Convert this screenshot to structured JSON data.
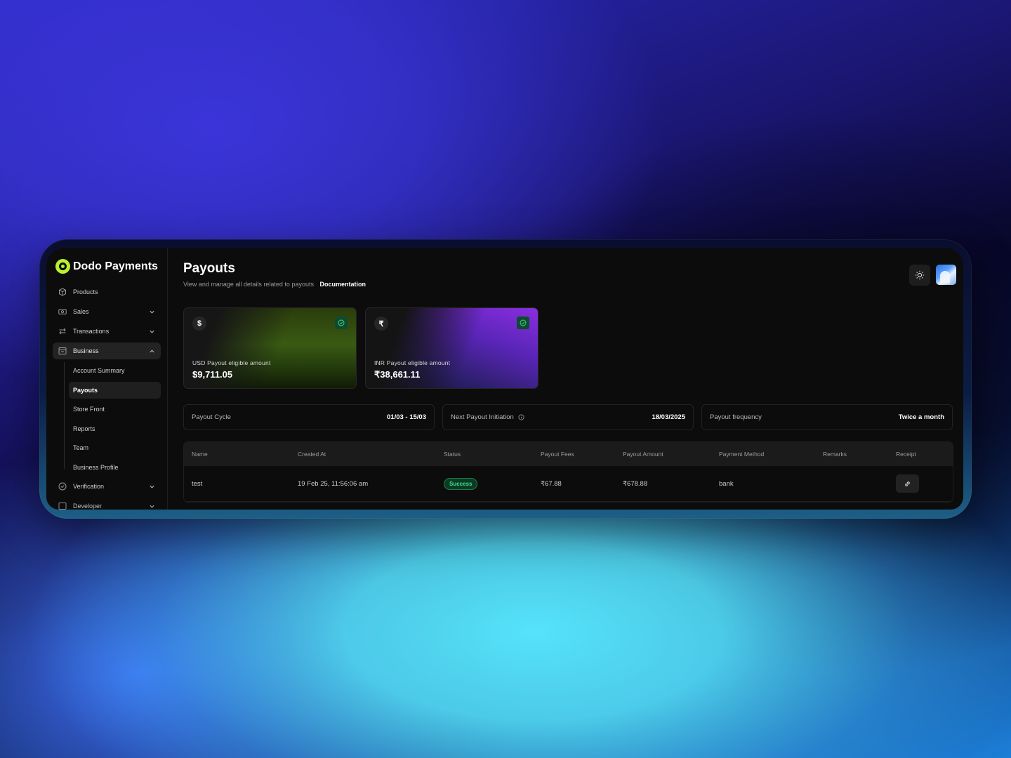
{
  "app": {
    "name": "Dodo Payments"
  },
  "sidebar": {
    "items": [
      {
        "label": "Products",
        "icon": "box-icon"
      },
      {
        "label": "Sales",
        "icon": "money-icon"
      },
      {
        "label": "Transactions",
        "icon": "arrows-icon"
      },
      {
        "label": "Business",
        "icon": "store-icon"
      },
      {
        "label": "Verification",
        "icon": "check-circle-icon"
      },
      {
        "label": "Developer",
        "icon": "code-icon"
      }
    ],
    "business_subitems": [
      "Account Summary",
      "Payouts",
      "Store Front",
      "Reports",
      "Team",
      "Business Profile"
    ],
    "active_subitem": "Payouts"
  },
  "header": {
    "title": "Payouts",
    "subtitle": "View and manage all details related to payouts",
    "doc_link": "Documentation"
  },
  "cards": [
    {
      "symbol": "$",
      "label": "USD Payout eligible amount",
      "amount": "$9,711.05"
    },
    {
      "symbol": "₹",
      "label": "INR Payout eligible amount",
      "amount": "₹38,661.11"
    }
  ],
  "info": {
    "cycle": {
      "label": "Payout Cycle",
      "value": "01/03 - 15/03"
    },
    "next": {
      "label": "Next Payout Initiation",
      "value": "18/03/2025"
    },
    "frequency": {
      "label": "Payout frequency",
      "value": "Twice a month"
    }
  },
  "table": {
    "headers": [
      "Name",
      "Created At",
      "Status",
      "Payout Fees",
      "Payout Amount",
      "Payment Method",
      "Remarks",
      "Receipt"
    ],
    "rows": [
      {
        "name": "test",
        "created_at": "19 Feb 25, 11:56:06 am",
        "status": "Success",
        "fees": "₹67.88",
        "amount": "₹678.88",
        "method": "bank",
        "remarks": ""
      }
    ]
  },
  "colors": {
    "accent": "#b8f22d",
    "success": "#3ee08a",
    "background": "#0c0c0c"
  }
}
